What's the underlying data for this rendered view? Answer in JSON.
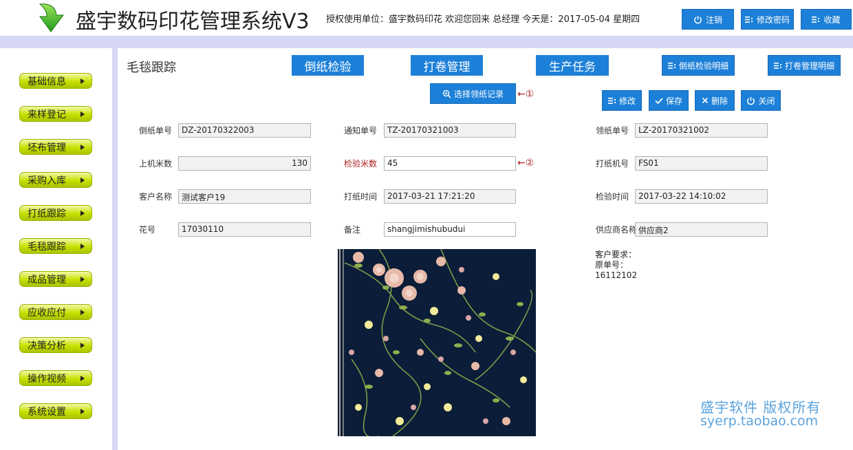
{
  "header": {
    "app_title": "盛宇数码印花管理系统V3",
    "user_info": "授权使用单位：盛宇数码印花 欢迎您回来 总经理 今天是：2017-05-04 星期四",
    "logout": "注销",
    "change_password": "修改密码",
    "favorites": "收藏"
  },
  "sidebar": {
    "items": [
      {
        "label": "基础信息"
      },
      {
        "label": "来样登记"
      },
      {
        "label": "坯布管理"
      },
      {
        "label": "采购入库"
      },
      {
        "label": "打纸跟踪"
      },
      {
        "label": "毛毯跟踪"
      },
      {
        "label": "成品管理"
      },
      {
        "label": "应收应付"
      },
      {
        "label": "决策分析"
      },
      {
        "label": "操作视频"
      },
      {
        "label": "系统设置"
      }
    ]
  },
  "main": {
    "page_title": "毛毯跟踪",
    "tabs": {
      "inspection": "倒纸检验",
      "rolling": "打卷管理",
      "production": "生产任务"
    },
    "detail_buttons": {
      "inspection_detail": "倒纸检验明细",
      "rolling_detail": "打卷管理明细"
    },
    "select_record": "选择领纸记录",
    "annotation_1": "←①",
    "annotation_2": "←②",
    "actions": {
      "edit": "修改",
      "save": "保存",
      "delete": "删除",
      "close": "关闭"
    },
    "form": {
      "daozhi_no_label": "倒纸单号",
      "daozhi_no": "DZ-20170322003",
      "notice_no_label": "通知单号",
      "notice_no": "TZ-20170321003",
      "lingzhi_no_label": "领纸单号",
      "lingzhi_no": "LZ-20170321002",
      "machine_meters_label": "上机米数",
      "machine_meters": "130",
      "inspect_meters_label": "检验米数",
      "inspect_meters": "45",
      "printer_no_label": "打纸机号",
      "printer_no": "FS01",
      "customer_label": "客户名称",
      "customer": "测试客户19",
      "print_time_label": "打纸时间",
      "print_time": "2017-03-21 17:21:20",
      "inspect_time_label": "检验时间",
      "inspect_time": "2017-03-22 14:10:02",
      "pattern_label": "花号",
      "pattern": "17030110",
      "remark_label": "备注",
      "remark": "shangjimishubudui",
      "supplier_label": "供应商名称",
      "supplier": "供应商2"
    },
    "notes": {
      "customer_req": "客户要求：",
      "orig_no_label": "原单号：",
      "orig_no": "16112102"
    },
    "watermark": {
      "line1": "盛宇软件 版权所有",
      "line2": "syerp.taobao.com"
    }
  },
  "colors": {
    "accent": "#1d80d8",
    "sidebar_item": "#c7e000",
    "band": "#d6d8f4",
    "label_red": "#b02020"
  }
}
